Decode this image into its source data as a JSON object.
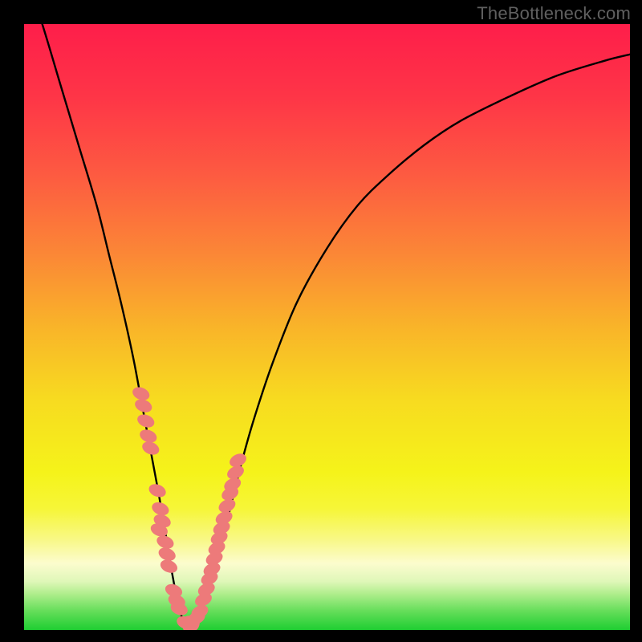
{
  "watermark": "TheBottleneck.com",
  "colors": {
    "frame": "#000000",
    "gradient_stops": [
      {
        "pos": 0.0,
        "color": "#fe1e4a"
      },
      {
        "pos": 0.12,
        "color": "#fe3547"
      },
      {
        "pos": 0.25,
        "color": "#fd5b41"
      },
      {
        "pos": 0.38,
        "color": "#fb8736"
      },
      {
        "pos": 0.5,
        "color": "#f9b429"
      },
      {
        "pos": 0.62,
        "color": "#f7db20"
      },
      {
        "pos": 0.74,
        "color": "#f5f31a"
      },
      {
        "pos": 0.8,
        "color": "#f6f638"
      },
      {
        "pos": 0.85,
        "color": "#f8f885"
      },
      {
        "pos": 0.89,
        "color": "#fcfcce"
      },
      {
        "pos": 0.92,
        "color": "#dff7b8"
      },
      {
        "pos": 0.94,
        "color": "#b0ee8d"
      },
      {
        "pos": 0.97,
        "color": "#62dd58"
      },
      {
        "pos": 1.0,
        "color": "#1fce32"
      }
    ],
    "curve": "#000000",
    "blob": "#ed7a7a"
  },
  "chart_data": {
    "type": "line",
    "title": "",
    "xlabel": "",
    "ylabel": "",
    "xlim": [
      0,
      100
    ],
    "ylim": [
      0,
      100
    ],
    "grid": false,
    "legend": false,
    "note": "Values read off pixel positions of a V-shaped bottleneck curve; y=0 at bottom (optimal), y=100 at top (worst).",
    "series": [
      {
        "name": "bottleneck-curve",
        "x": [
          0,
          3,
          6,
          9,
          12,
          14,
          16,
          18,
          19.5,
          21,
          22.3,
          23.5,
          24.5,
          25.5,
          26.5,
          27.5,
          28.5,
          30,
          32,
          34,
          36,
          38,
          41,
          45,
          50,
          55,
          60,
          66,
          72,
          80,
          88,
          96,
          100
        ],
        "values": [
          109,
          100,
          90,
          80,
          70,
          62,
          54,
          45,
          37,
          29,
          22,
          15,
          9,
          4,
          1,
          0,
          1,
          5,
          12,
          20,
          28,
          35,
          44,
          54,
          63,
          70,
          75,
          80,
          84,
          88,
          91.5,
          94,
          95
        ]
      }
    ],
    "markers": {
      "name": "salmon-blobs",
      "color": "#ed7a7a",
      "note": "Clusters of lozenge-shaped salmon markers along the curve near the minimum.",
      "points_xy": [
        [
          19.3,
          39
        ],
        [
          19.7,
          37
        ],
        [
          20.1,
          34.5
        ],
        [
          20.5,
          32
        ],
        [
          20.9,
          30
        ],
        [
          22.0,
          23
        ],
        [
          22.5,
          20
        ],
        [
          22.8,
          18
        ],
        [
          22.3,
          16.5
        ],
        [
          23.3,
          14.5
        ],
        [
          23.6,
          12.5
        ],
        [
          23.9,
          10.5
        ],
        [
          24.7,
          6.5
        ],
        [
          25.2,
          4.8
        ],
        [
          25.6,
          3.5
        ],
        [
          26.6,
          1.2
        ],
        [
          27.1,
          0.9
        ],
        [
          27.6,
          0.9
        ],
        [
          28.0,
          1.3
        ],
        [
          28.5,
          2.0
        ],
        [
          29.0,
          3.0
        ],
        [
          29.6,
          5.0
        ],
        [
          30.1,
          6.7
        ],
        [
          30.6,
          8.5
        ],
        [
          31.0,
          10.0
        ],
        [
          31.4,
          11.8
        ],
        [
          31.8,
          13.5
        ],
        [
          32.2,
          15.2
        ],
        [
          32.6,
          16.8
        ],
        [
          33.0,
          18.5
        ],
        [
          33.5,
          20.5
        ],
        [
          34.0,
          22.5
        ],
        [
          34.4,
          24.0
        ],
        [
          34.9,
          26.0
        ],
        [
          35.3,
          28.0
        ]
      ]
    }
  }
}
